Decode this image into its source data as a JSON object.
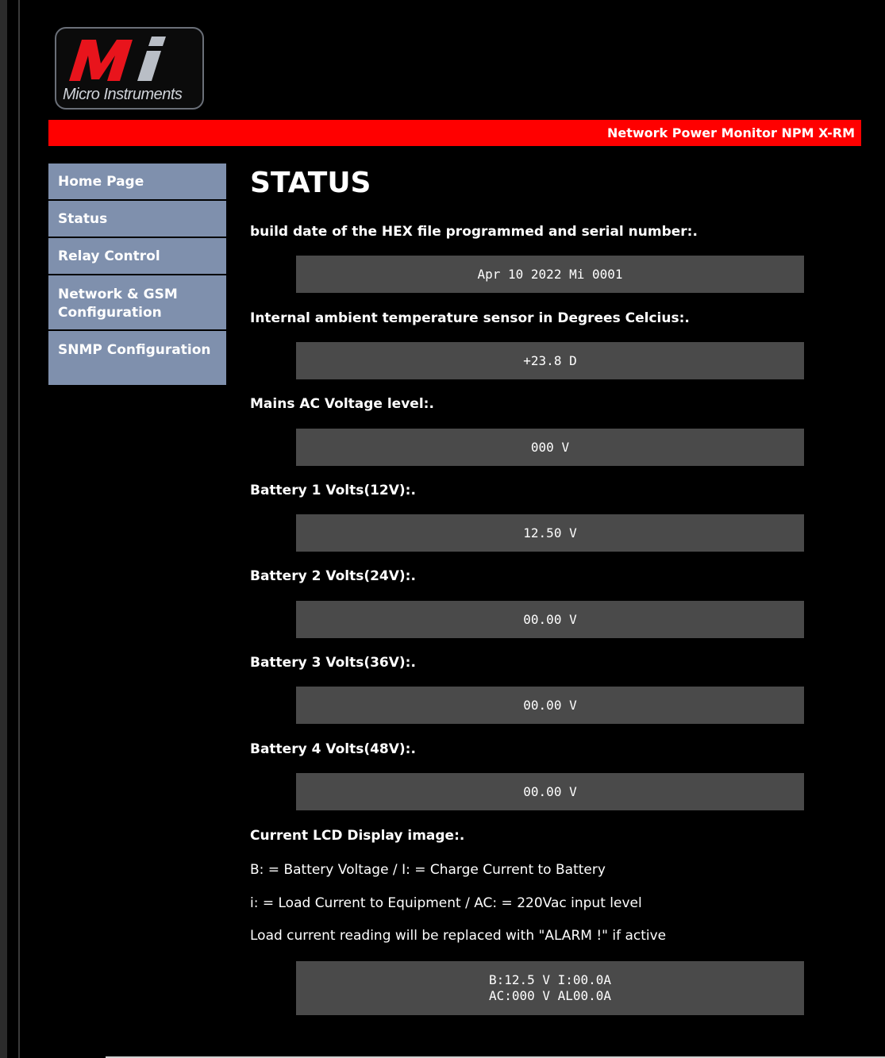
{
  "logo": {
    "mark": "Mi",
    "text": "Micro Instruments"
  },
  "banner": {
    "title": "Network Power Monitor NPM X-RM"
  },
  "sidebar": {
    "items": [
      {
        "label": "Home Page"
      },
      {
        "label": "Status"
      },
      {
        "label": "Relay Control"
      },
      {
        "label": "Network & GSM Configuration"
      },
      {
        "label": "SNMP Configuration"
      }
    ]
  },
  "main": {
    "title": "STATUS",
    "sections": [
      {
        "label": "build date of the HEX file programmed and serial number:.",
        "value": "Apr 10 2022 Mi 0001"
      },
      {
        "label": "Internal ambient temperature sensor in Degrees Celcius:.",
        "value": "+23.8 D"
      },
      {
        "label": "Mains AC Voltage level:.",
        "value": "000 V"
      },
      {
        "label": "Battery 1 Volts(12V):.",
        "value": "12.50 V"
      },
      {
        "label": "Battery 2 Volts(24V):.",
        "value": "00.00 V"
      },
      {
        "label": "Battery 3 Volts(36V):.",
        "value": "00.00 V"
      },
      {
        "label": "Battery 4 Volts(48V):.",
        "value": "00.00 V"
      }
    ],
    "lcd": {
      "label": "Current LCD Display image:.",
      "notes": [
        "B: = Battery Voltage / I: = Charge Current to Battery",
        "i: = Load Current to Equipment / AC: = 220Vac input level",
        "Load current reading will be replaced with \"ALARM !\" if active"
      ],
      "line1": "B:12.5 V I:00.0A",
      "line2": "AC:000 V AL00.0A"
    }
  },
  "colors": {
    "background": "#000000",
    "banner": "#ff0000",
    "nav": "#7f90ad",
    "value_box": "#4a4a4a",
    "logo_red": "#e8141c"
  }
}
